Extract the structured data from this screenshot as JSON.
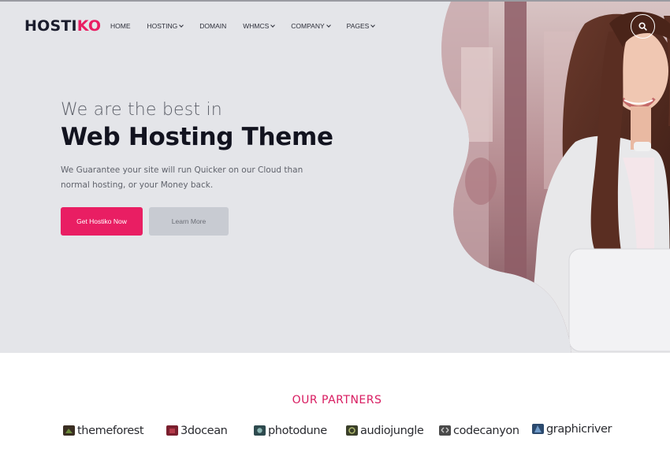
{
  "header": {
    "logo_main": "HOSTI",
    "logo_accent": "KO",
    "nav": [
      {
        "label": "HOME",
        "dropdown": false
      },
      {
        "label": "HOSTING",
        "dropdown": true
      },
      {
        "label": "DOMAIN",
        "dropdown": false
      },
      {
        "label": "WHMCS",
        "dropdown": true
      },
      {
        "label": "COMPANY",
        "dropdown": true
      },
      {
        "label": "PAGES",
        "dropdown": true
      }
    ],
    "search_icon": "search-icon"
  },
  "hero": {
    "subtitle": "We are the best in",
    "title": "Web Hosting Theme",
    "description": "We Guarantee your site will run Quicker on our Cloud than normal hosting, or your Money back.",
    "primary_button": "Get Hostiko Now",
    "secondary_button": "Learn More"
  },
  "partners": {
    "title": "OUR PARTNERS",
    "items": [
      {
        "name": "themeforest",
        "icon": "themeforest-icon"
      },
      {
        "name": "3docean",
        "icon": "3docean-icon"
      },
      {
        "name": "photodune",
        "icon": "photodune-icon"
      },
      {
        "name": "audiojungle",
        "icon": "audiojungle-icon"
      },
      {
        "name": "codecanyon",
        "icon": "codecanyon-icon"
      },
      {
        "name": "graphicriver",
        "icon": "graphicriver-icon"
      }
    ]
  },
  "colors": {
    "accent": "#e91e63",
    "hero_bg": "#e4e5e9",
    "text_dark": "#12131f",
    "secondary_btn": "#c8cbd2"
  }
}
